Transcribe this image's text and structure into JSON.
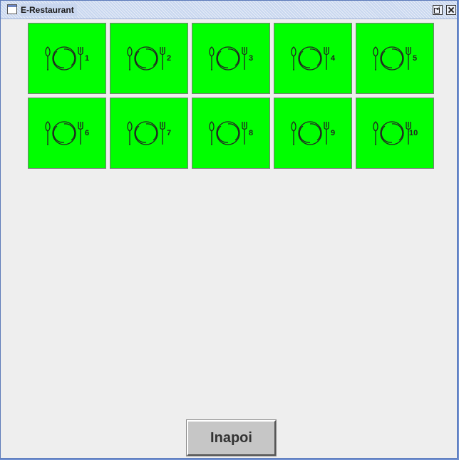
{
  "window": {
    "title": "E-Restaurant"
  },
  "tables": [
    {
      "label": "1",
      "status_color": "#00ff00"
    },
    {
      "label": "2",
      "status_color": "#00ff00"
    },
    {
      "label": "3",
      "status_color": "#00ff00"
    },
    {
      "label": "4",
      "status_color": "#00ff00"
    },
    {
      "label": "5",
      "status_color": "#00ff00"
    },
    {
      "label": "6",
      "status_color": "#00ff00"
    },
    {
      "label": "7",
      "status_color": "#00ff00"
    },
    {
      "label": "8",
      "status_color": "#00ff00"
    },
    {
      "label": "9",
      "status_color": "#00ff00"
    },
    {
      "label": "10",
      "status_color": "#00ff00"
    }
  ],
  "table_icon": "plate-cutlery-icon",
  "actions": {
    "back_label": "Inapoi"
  }
}
